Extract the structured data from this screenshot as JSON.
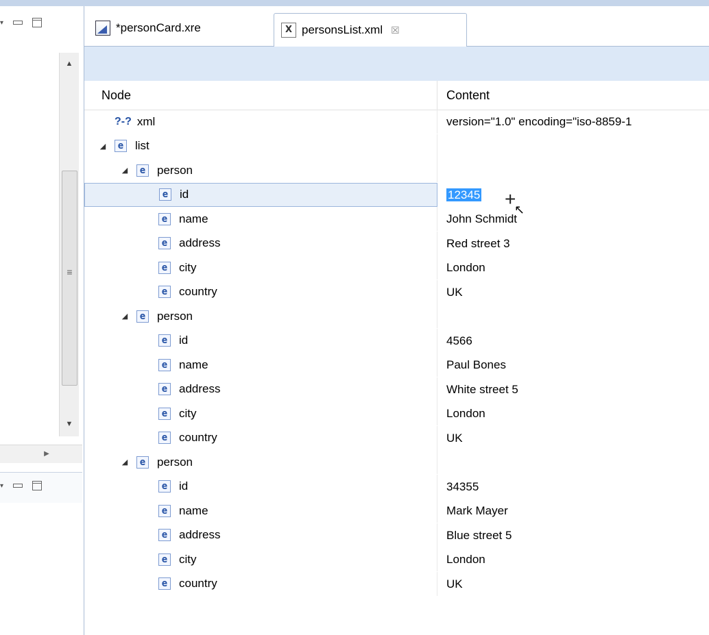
{
  "editor": {
    "tabs": [
      {
        "label": "*personCard.xre",
        "icon": "xre-file-icon",
        "active": false
      },
      {
        "label": "personsList.xml",
        "icon": "xml-file-icon",
        "active": true,
        "close": "☒"
      }
    ]
  },
  "table": {
    "columns": {
      "node": "Node",
      "content": "Content"
    },
    "rows": [
      {
        "node": "xml",
        "content": "version=\"1.0\" encoding=\"iso-8859-1",
        "level": 0,
        "kind": "pi",
        "pi_label": "?-?"
      },
      {
        "node": "list",
        "content": "",
        "level": 0,
        "kind": "element",
        "expanded": true
      },
      {
        "node": "person",
        "content": "",
        "level": 1,
        "kind": "element",
        "expanded": true
      },
      {
        "node": "id",
        "content": "12345",
        "level": 2,
        "kind": "element",
        "selected": true
      },
      {
        "node": "name",
        "content": "John Schmidt",
        "level": 2,
        "kind": "element"
      },
      {
        "node": "address",
        "content": "Red street 3",
        "level": 2,
        "kind": "element"
      },
      {
        "node": "city",
        "content": "London",
        "level": 2,
        "kind": "element"
      },
      {
        "node": "country",
        "content": "UK",
        "level": 2,
        "kind": "element"
      },
      {
        "node": "person",
        "content": "",
        "level": 1,
        "kind": "element",
        "expanded": true
      },
      {
        "node": "id",
        "content": "4566",
        "level": 2,
        "kind": "element"
      },
      {
        "node": "name",
        "content": "Paul  Bones",
        "level": 2,
        "kind": "element"
      },
      {
        "node": "address",
        "content": "White street 5",
        "level": 2,
        "kind": "element"
      },
      {
        "node": "city",
        "content": "London",
        "level": 2,
        "kind": "element"
      },
      {
        "node": "country",
        "content": "UK",
        "level": 2,
        "kind": "element"
      },
      {
        "node": "person",
        "content": "",
        "level": 1,
        "kind": "element",
        "expanded": true
      },
      {
        "node": "id",
        "content": "34355",
        "level": 2,
        "kind": "element"
      },
      {
        "node": "name",
        "content": "Mark Mayer",
        "level": 2,
        "kind": "element"
      },
      {
        "node": "address",
        "content": "Blue street 5",
        "level": 2,
        "kind": "element"
      },
      {
        "node": "city",
        "content": "London",
        "level": 2,
        "kind": "element"
      },
      {
        "node": "country",
        "content": "UK",
        "level": 2,
        "kind": "element"
      }
    ]
  },
  "icons": {
    "element_letter": "e",
    "twisty_expanded": "◢",
    "scroll_grip": "≡"
  },
  "colors": {
    "selection": "#3399ff",
    "toolbar": "#dce8f7",
    "border": "#a9bcd6"
  }
}
